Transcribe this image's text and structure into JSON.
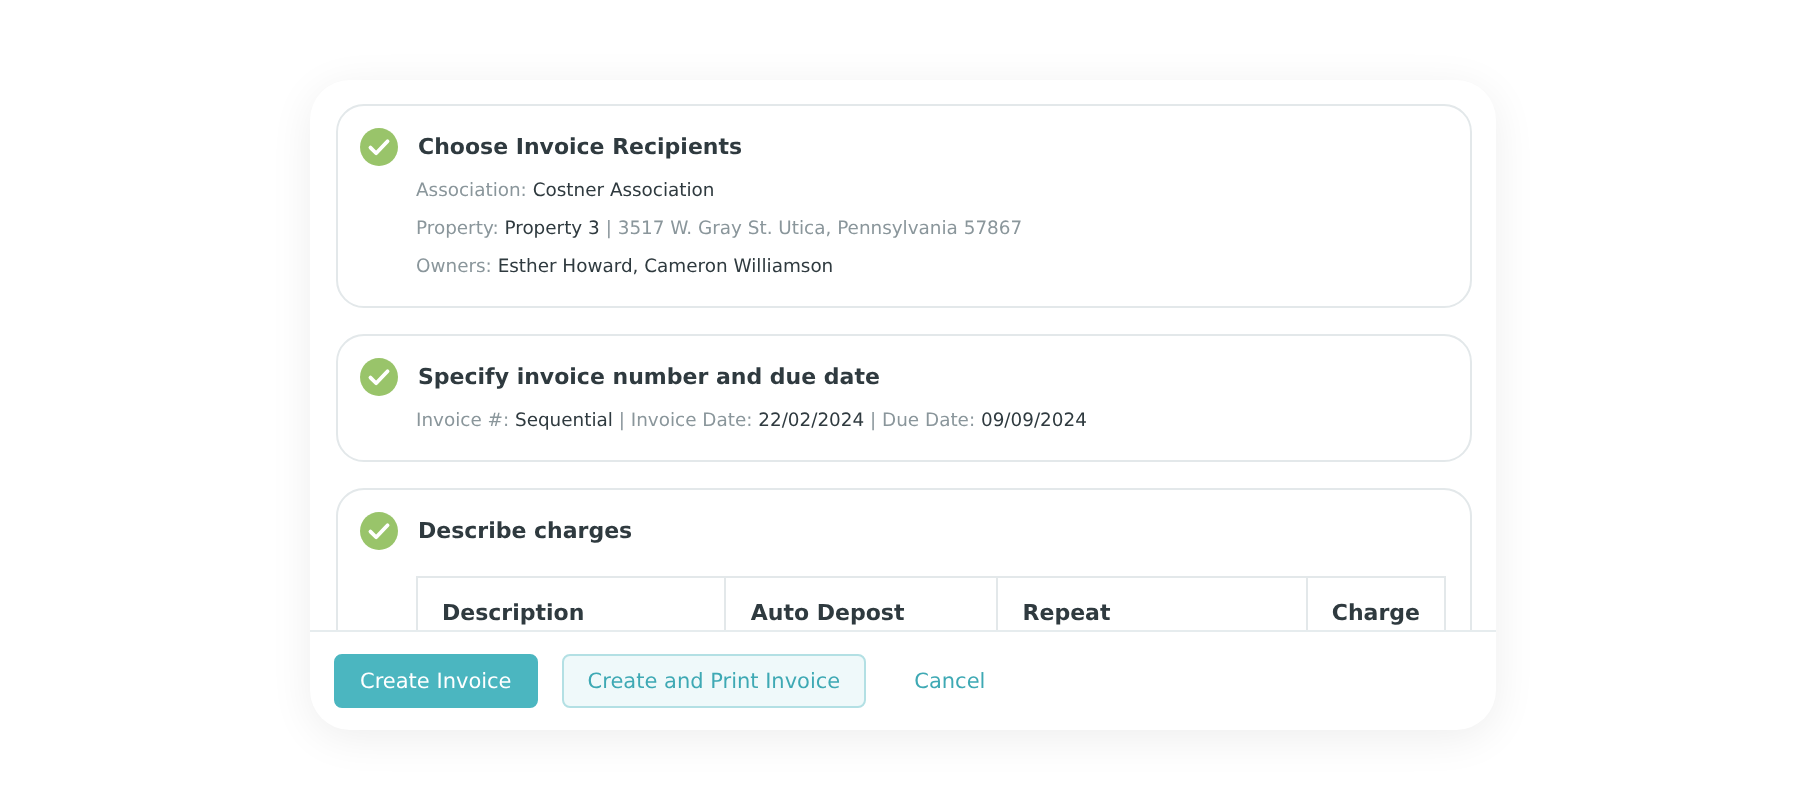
{
  "steps": [
    {
      "title": "Choose Invoice Recipients",
      "done": true,
      "lines": [
        [
          {
            "kind": "label",
            "text": "Association:"
          },
          {
            "kind": "value",
            "text": "Costner Association"
          }
        ],
        [
          {
            "kind": "label",
            "text": "Property:"
          },
          {
            "kind": "value",
            "text": "Property 3"
          },
          {
            "kind": "label",
            "text": "|"
          },
          {
            "kind": "label",
            "text": "3517 W. Gray St. Utica, Pennsylvania 57867"
          }
        ],
        [
          {
            "kind": "label",
            "text": "Owners:"
          },
          {
            "kind": "value",
            "text": " Esther Howard, Cameron Williamson"
          }
        ]
      ]
    },
    {
      "title": "Specify invoice number and due date",
      "done": true,
      "lines": [
        [
          {
            "kind": "label",
            "text": "Invoice #:"
          },
          {
            "kind": "value",
            "text": "Sequential"
          },
          {
            "kind": "label",
            "text": "| Invoice Date:"
          },
          {
            "kind": "value",
            "text": "22/02/2024"
          },
          {
            "kind": "label",
            "text": "| Due Date:"
          },
          {
            "kind": "value",
            "text": "09/09/2024"
          }
        ]
      ]
    },
    {
      "title": "Describe charges",
      "done": true,
      "table": {
        "columns": [
          "Description",
          "Auto Depost",
          "Repeat",
          "Charge"
        ]
      }
    }
  ],
  "buttons": [
    {
      "label": "Create Invoice",
      "kind": "primary"
    },
    {
      "label": "Create and Print Invoice",
      "kind": "secondary"
    },
    {
      "label": "Cancel",
      "kind": "link"
    }
  ]
}
